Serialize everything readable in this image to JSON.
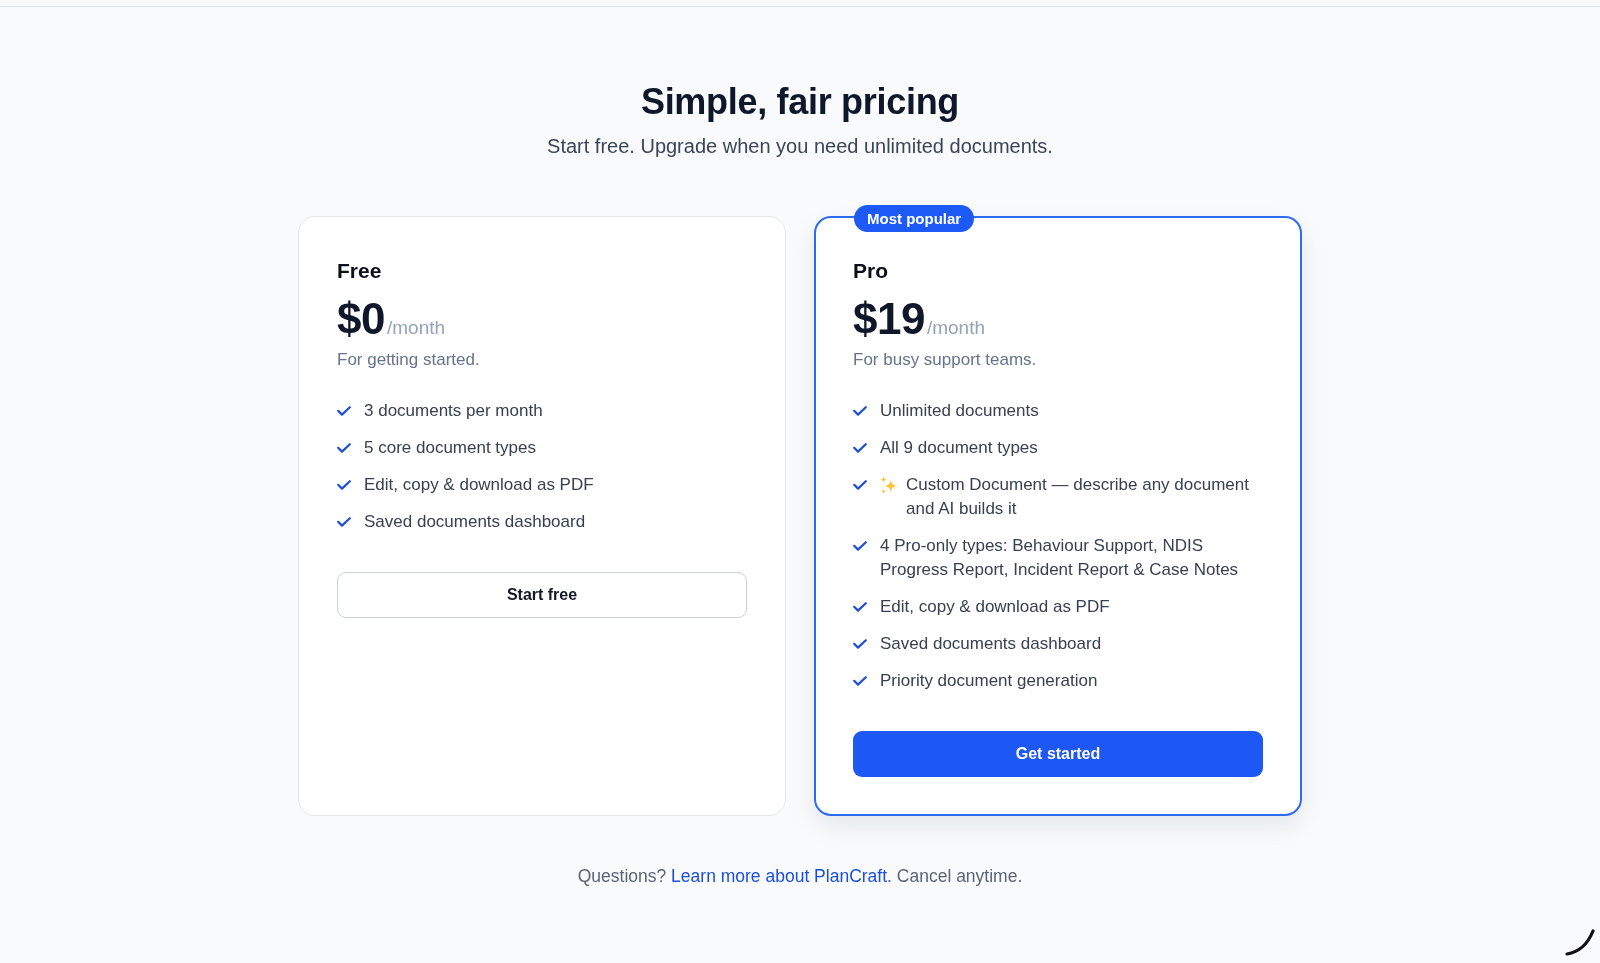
{
  "header": {
    "title": "Simple, fair pricing",
    "subtitle": "Start free. Upgrade when you need unlimited documents."
  },
  "plans": [
    {
      "name": "Free",
      "price": "$0",
      "period": "/month",
      "description": "For getting started.",
      "highlighted": false,
      "features": [
        {
          "kind": "text",
          "text": "3 documents per month"
        },
        {
          "kind": "text",
          "text": "5 core document types"
        },
        {
          "kind": "text",
          "text": "Edit, copy & download as PDF"
        },
        {
          "kind": "text",
          "text": "Saved documents dashboard"
        }
      ],
      "button": "Start free"
    },
    {
      "name": "Pro",
      "badge": "Most popular",
      "price": "$19",
      "period": "/month",
      "description": "For busy support teams.",
      "highlighted": true,
      "features": [
        {
          "kind": "text",
          "text": "Unlimited documents"
        },
        {
          "kind": "text",
          "text": "All 9 document types"
        },
        {
          "kind": "sparkle",
          "text": "Custom Document — describe any document and AI builds it"
        },
        {
          "kind": "text",
          "text": "4 Pro-only types: Behaviour Support, NDIS Progress Report, Incident Report & Case Notes"
        },
        {
          "kind": "text",
          "text": "Edit, copy & download as PDF"
        },
        {
          "kind": "text",
          "text": "Saved documents dashboard"
        },
        {
          "kind": "text",
          "text": "Priority document generation"
        }
      ],
      "button": "Get started"
    }
  ],
  "footer": {
    "before": "Questions?",
    "link": "Learn more about PlanCraft",
    "after": ". Cancel anytime."
  }
}
